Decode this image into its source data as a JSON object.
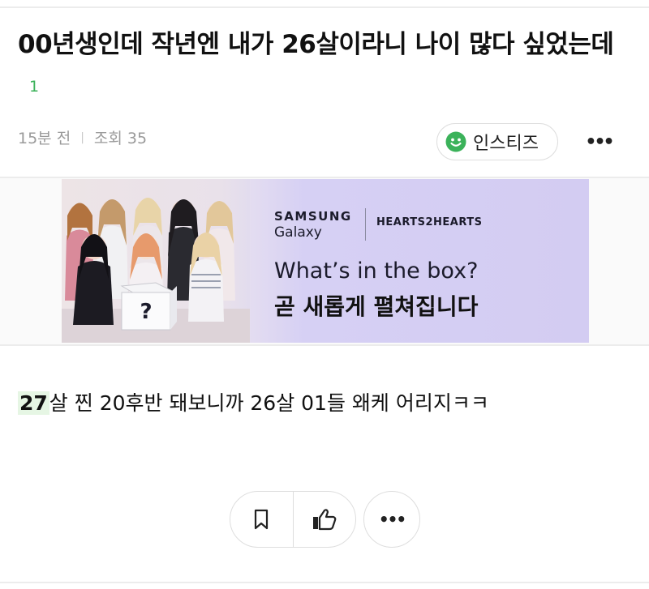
{
  "post": {
    "title": "00년생인데 작년엔 내가 26살이라니 나이 많다 싶었는데",
    "comment_count": "1",
    "time_ago": "15분 전",
    "views": "조회 35",
    "source": "인스티즈",
    "more_icon": "more-horizontal-icon",
    "body_highlight": "27",
    "body_text": "살 찐 20후반 돼보니까 26살 01들 왜케 어리지ㅋㅋ"
  },
  "ad": {
    "brand": "SAMSUNG",
    "brand_line2": "Galaxy",
    "partner": "HEARTS2HEARTS",
    "tagline": "What’s in the box?",
    "tagline_ko": "곧 새롭게 펼쳐집니다",
    "box_mark": "?"
  },
  "actions": {
    "bookmark_icon": "bookmark-icon",
    "like_icon": "thumbs-up-icon",
    "more_icon": "more-horizontal-icon"
  },
  "colors": {
    "accent_green": "#3bb25a",
    "highlight_bg": "#e6f6e4",
    "ad_purple": "#d3ccf2"
  }
}
